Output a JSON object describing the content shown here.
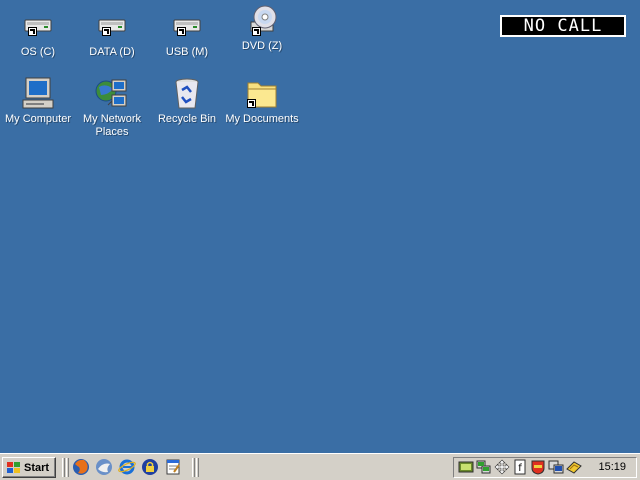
{
  "desktop": {
    "background": "#3a6ea5",
    "icons": [
      {
        "label": "OS (C)",
        "icon": "drive-icon"
      },
      {
        "label": "DATA (D)",
        "icon": "drive-icon"
      },
      {
        "label": "USB (M)",
        "icon": "drive-icon"
      },
      {
        "label": "DVD (Z)",
        "icon": "dvd-icon"
      },
      {
        "label": "My Computer",
        "icon": "computer-icon"
      },
      {
        "label": "My Network Places",
        "icon": "network-icon"
      },
      {
        "label": "Recycle Bin",
        "icon": "recycle-bin-icon"
      },
      {
        "label": "My Documents",
        "icon": "folder-icon"
      }
    ]
  },
  "call_status": "NO CALL",
  "taskbar": {
    "start_label": "Start",
    "quick_launch": [
      "firefox-icon",
      "thunderbird-icon",
      "internet-explorer-icon",
      "lock-icon",
      "notepad-icon"
    ],
    "tray_icons": [
      "display-icon",
      "network-tray-icon",
      "move-icon",
      "keyboard-icon",
      "shield-icon",
      "monitor-icon",
      "tool-icon"
    ],
    "clock": "15:19"
  }
}
